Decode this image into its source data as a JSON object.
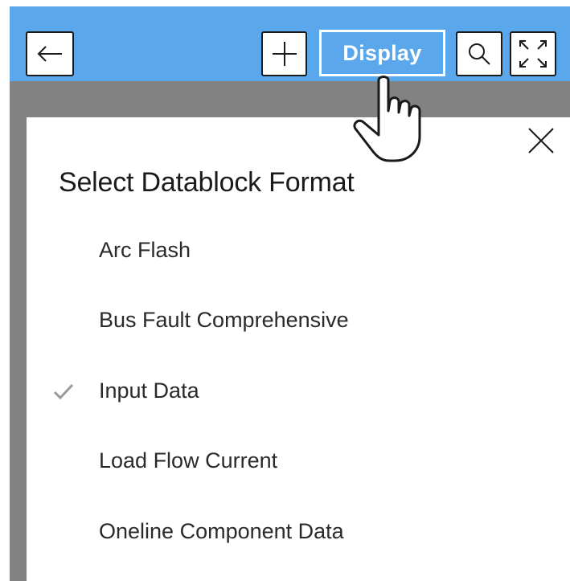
{
  "toolbar": {
    "display_label": "Display",
    "icons": {
      "back": "arrow-left-icon",
      "add": "plus-icon",
      "search": "magnifier-icon",
      "expand": "expand-icon"
    }
  },
  "panel": {
    "title": "Select Datablock Format",
    "close_icon": "close-icon",
    "options": [
      {
        "label": "Arc Flash",
        "checked": false
      },
      {
        "label": "Bus Fault Comprehensive",
        "checked": false
      },
      {
        "label": "Input Data",
        "checked": true
      },
      {
        "label": "Load Flow Current",
        "checked": false
      },
      {
        "label": "Oneline Component Data",
        "checked": false
      }
    ]
  },
  "colors": {
    "toolbar": "#5aa7ec",
    "backdrop": "#828282",
    "check": "#9a9a9a"
  }
}
